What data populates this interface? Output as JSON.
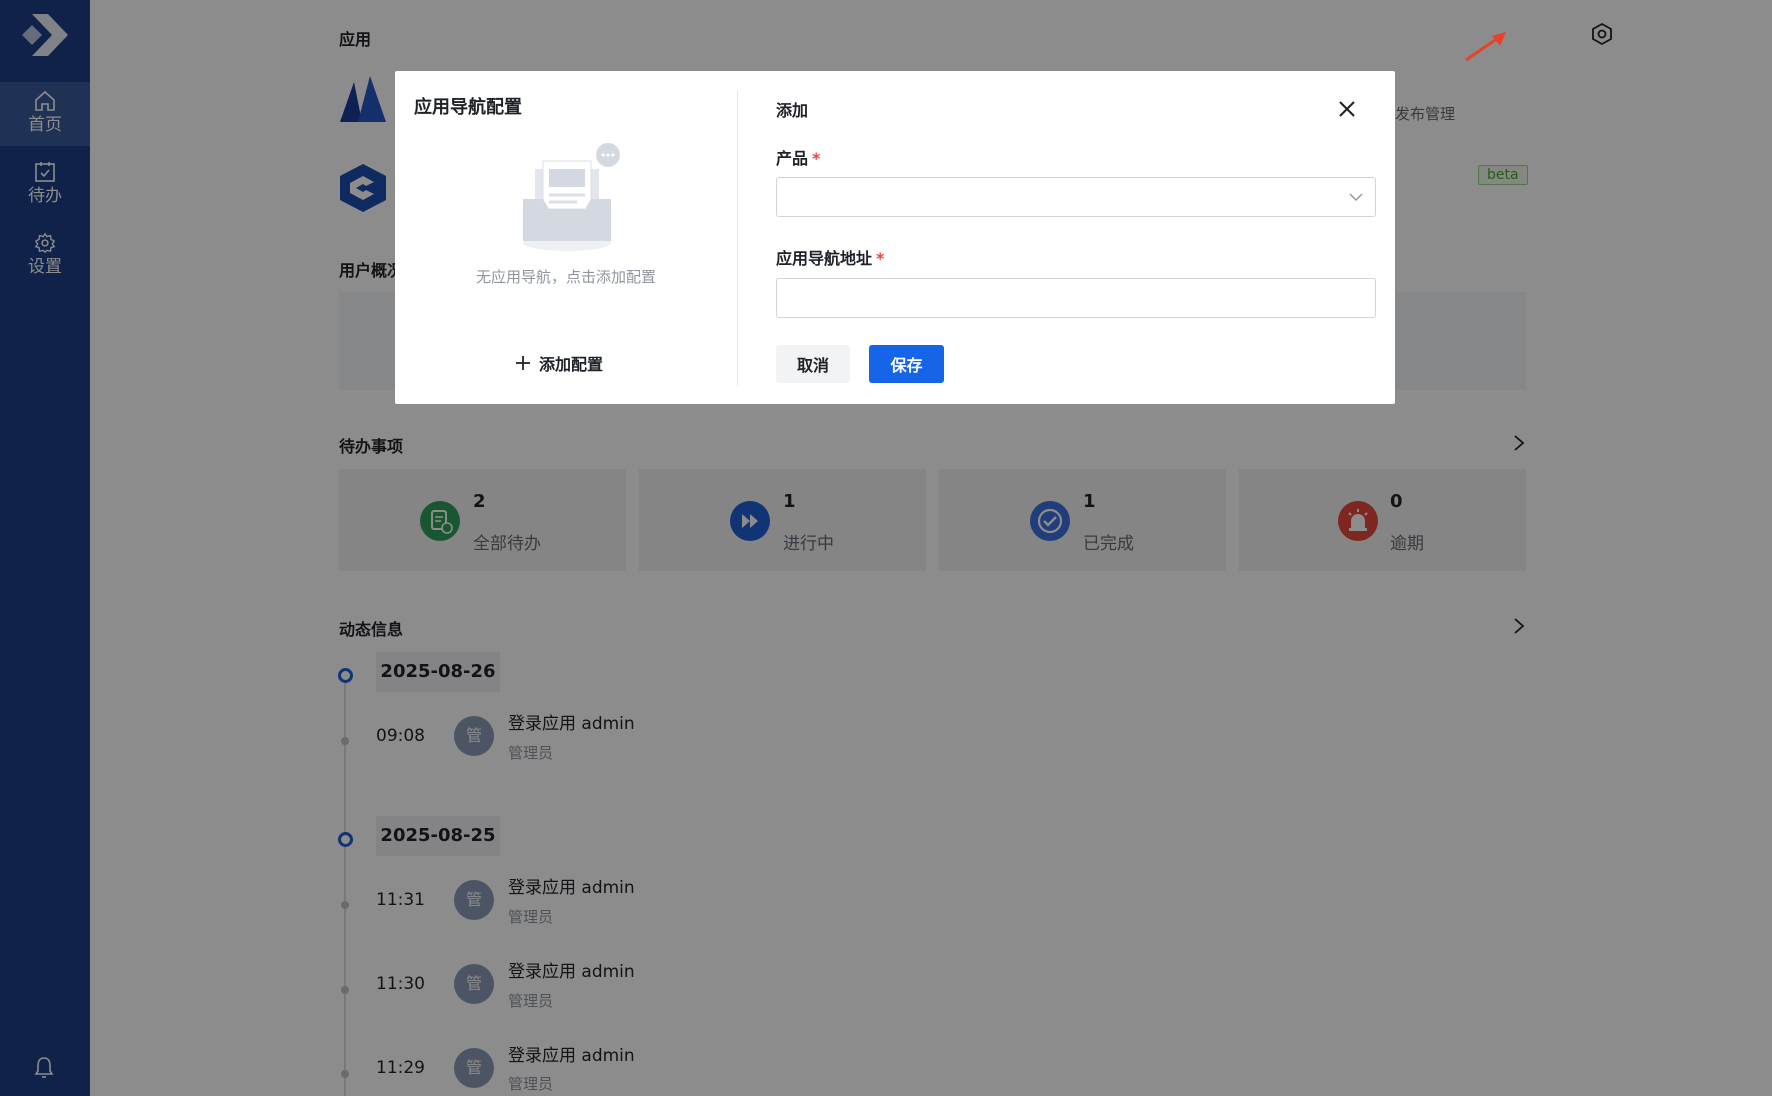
{
  "sidebar": {
    "items": [
      {
        "label": "首页",
        "icon": "home-icon"
      },
      {
        "label": "待办",
        "icon": "calendar-check-icon"
      },
      {
        "label": "设置",
        "icon": "gear-icon"
      }
    ],
    "brand_color": "#1e3f85"
  },
  "apps": {
    "title": "应用",
    "partial_text_1": "发布管理",
    "badge": "beta"
  },
  "user_overview": {
    "title": "用户概况"
  },
  "todo": {
    "title": "待办事项",
    "cards": [
      {
        "count": "2",
        "label": "全部待办",
        "color": "#2e9e5b"
      },
      {
        "count": "1",
        "label": "进行中",
        "color": "#1f5fd6"
      },
      {
        "count": "1",
        "label": "已完成",
        "color": "#3d6fe0"
      },
      {
        "count": "0",
        "label": "逾期",
        "color": "#e5473b"
      }
    ]
  },
  "activity": {
    "title": "动态信息",
    "groups": [
      {
        "date": "2025-08-26",
        "entries": [
          {
            "time": "09:08",
            "avatar": "管",
            "title": "登录应用 admin",
            "role": "管理员"
          }
        ]
      },
      {
        "date": "2025-08-25",
        "entries": [
          {
            "time": "11:31",
            "avatar": "管",
            "title": "登录应用 admin",
            "role": "管理员"
          },
          {
            "time": "11:30",
            "avatar": "管",
            "title": "登录应用 admin",
            "role": "管理员"
          },
          {
            "time": "11:29",
            "avatar": "管",
            "title": "登录应用 admin",
            "role": "管理员"
          }
        ]
      }
    ]
  },
  "modal": {
    "left_title": "应用导航配置",
    "empty_text": "无应用导航，点击添加配置",
    "add_config_label": "添加配置",
    "right_title": "添加",
    "product_label": "产品",
    "product_value": "",
    "nav_url_label": "应用导航地址",
    "nav_url_value": "",
    "required_mark": "*",
    "cancel_label": "取消",
    "save_label": "保存",
    "primary_color": "#1664e8"
  }
}
